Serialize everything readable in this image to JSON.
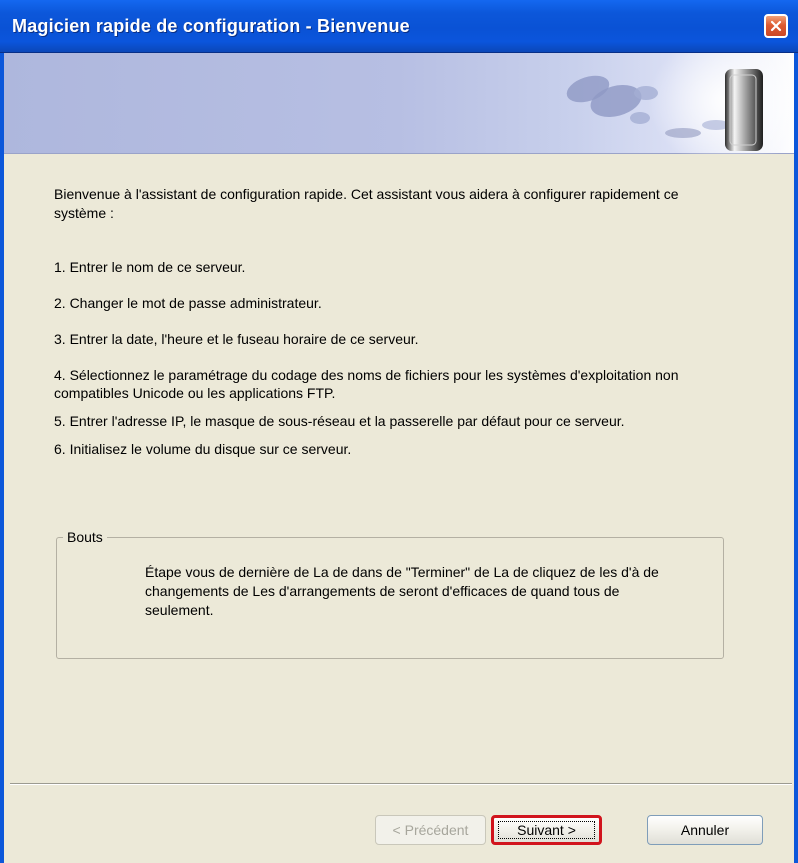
{
  "window": {
    "title": "Magicien rapide de configuration - Bienvenue"
  },
  "intro": {
    "text": "Bienvenue à l'assistant de configuration rapide. Cet assistant vous aidera à configurer rapidement ce système :"
  },
  "steps": [
    "1. Entrer le nom de ce serveur.",
    "2. Changer le mot de passe administrateur.",
    "3. Entrer la date, l'heure et le fuseau horaire de ce serveur.",
    "4. Sélectionnez le paramétrage du codage des noms de fichiers pour les systèmes d'exploitation non compatibles Unicode ou les applications FTP.",
    "5. Entrer l'adresse IP, le masque de sous-réseau et la passerelle par défaut pour ce serveur.",
    "6. Initialisez le volume du disque sur ce serveur."
  ],
  "tips": {
    "title": "Bouts",
    "text": "Étape vous de dernière de La de dans de \"Terminer\" de La de cliquez de les d'à de changements de Les d'arrangements de seront d'efficaces de quand tous de seulement."
  },
  "buttons": {
    "previous": "< Précédent",
    "next": "Suivant >",
    "cancel": "Annuler"
  },
  "colors": {
    "title_bar": "#0a52d5",
    "dialog_background": "#ece9d8",
    "focus_border": "#d1141d"
  },
  "icons": {
    "close": "close-icon",
    "banner": "external-drive-icon"
  }
}
